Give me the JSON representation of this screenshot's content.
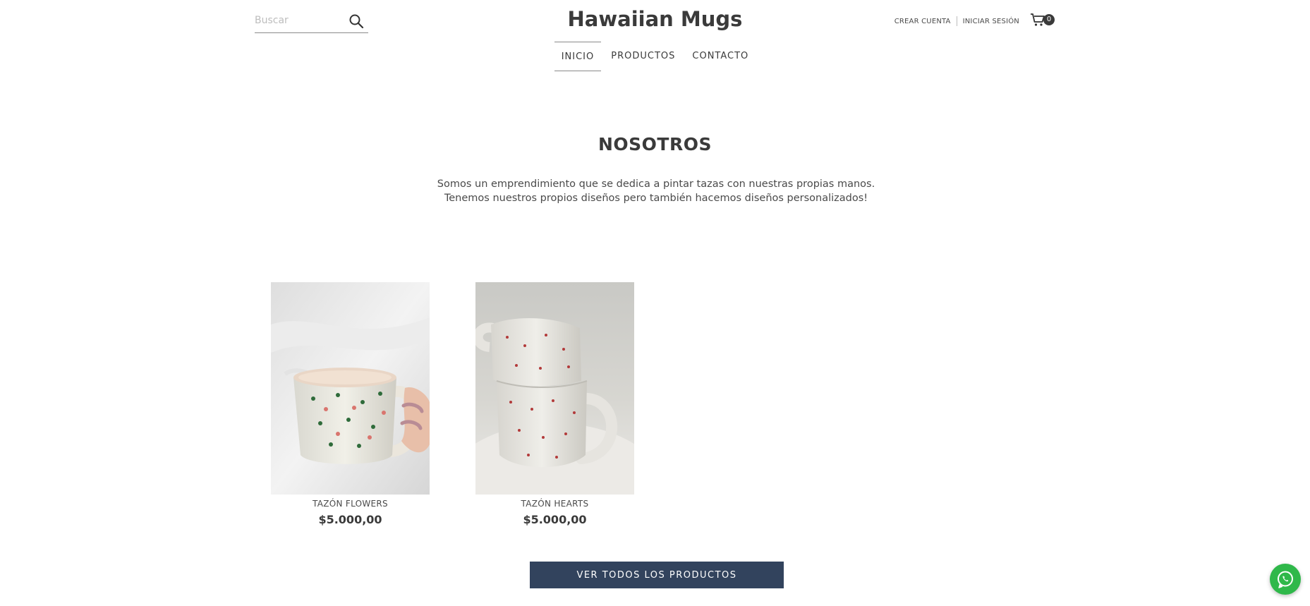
{
  "header": {
    "search_placeholder": "Buscar",
    "brand": "Hawaiian Mugs",
    "create_account": "CREAR CUENTA",
    "login": "INICIAR SESIÓN",
    "cart_count": "0"
  },
  "nav": {
    "items": [
      {
        "label": "INICIO",
        "active": true
      },
      {
        "label": "PRODUCTOS",
        "active": false
      },
      {
        "label": "CONTACTO",
        "active": false
      }
    ]
  },
  "about": {
    "title": "NOSOTROS",
    "text": "Somos un emprendimiento que se dedica a pintar tazas con nuestras propias manos. Tenemos nuestros propios diseños pero también hacemos diseños personalizados!"
  },
  "products": [
    {
      "name": "TAZÓN FLOWERS",
      "price": "$5.000,00"
    },
    {
      "name": "TAZÓN HEARTS",
      "price": "$5.000,00"
    }
  ],
  "cta": {
    "view_all": "VER TODOS LOS PRODUCTOS"
  },
  "colors": {
    "cta_bg": "#32435d",
    "whatsapp": "#2fb84a",
    "text": "#3a3a3a"
  }
}
